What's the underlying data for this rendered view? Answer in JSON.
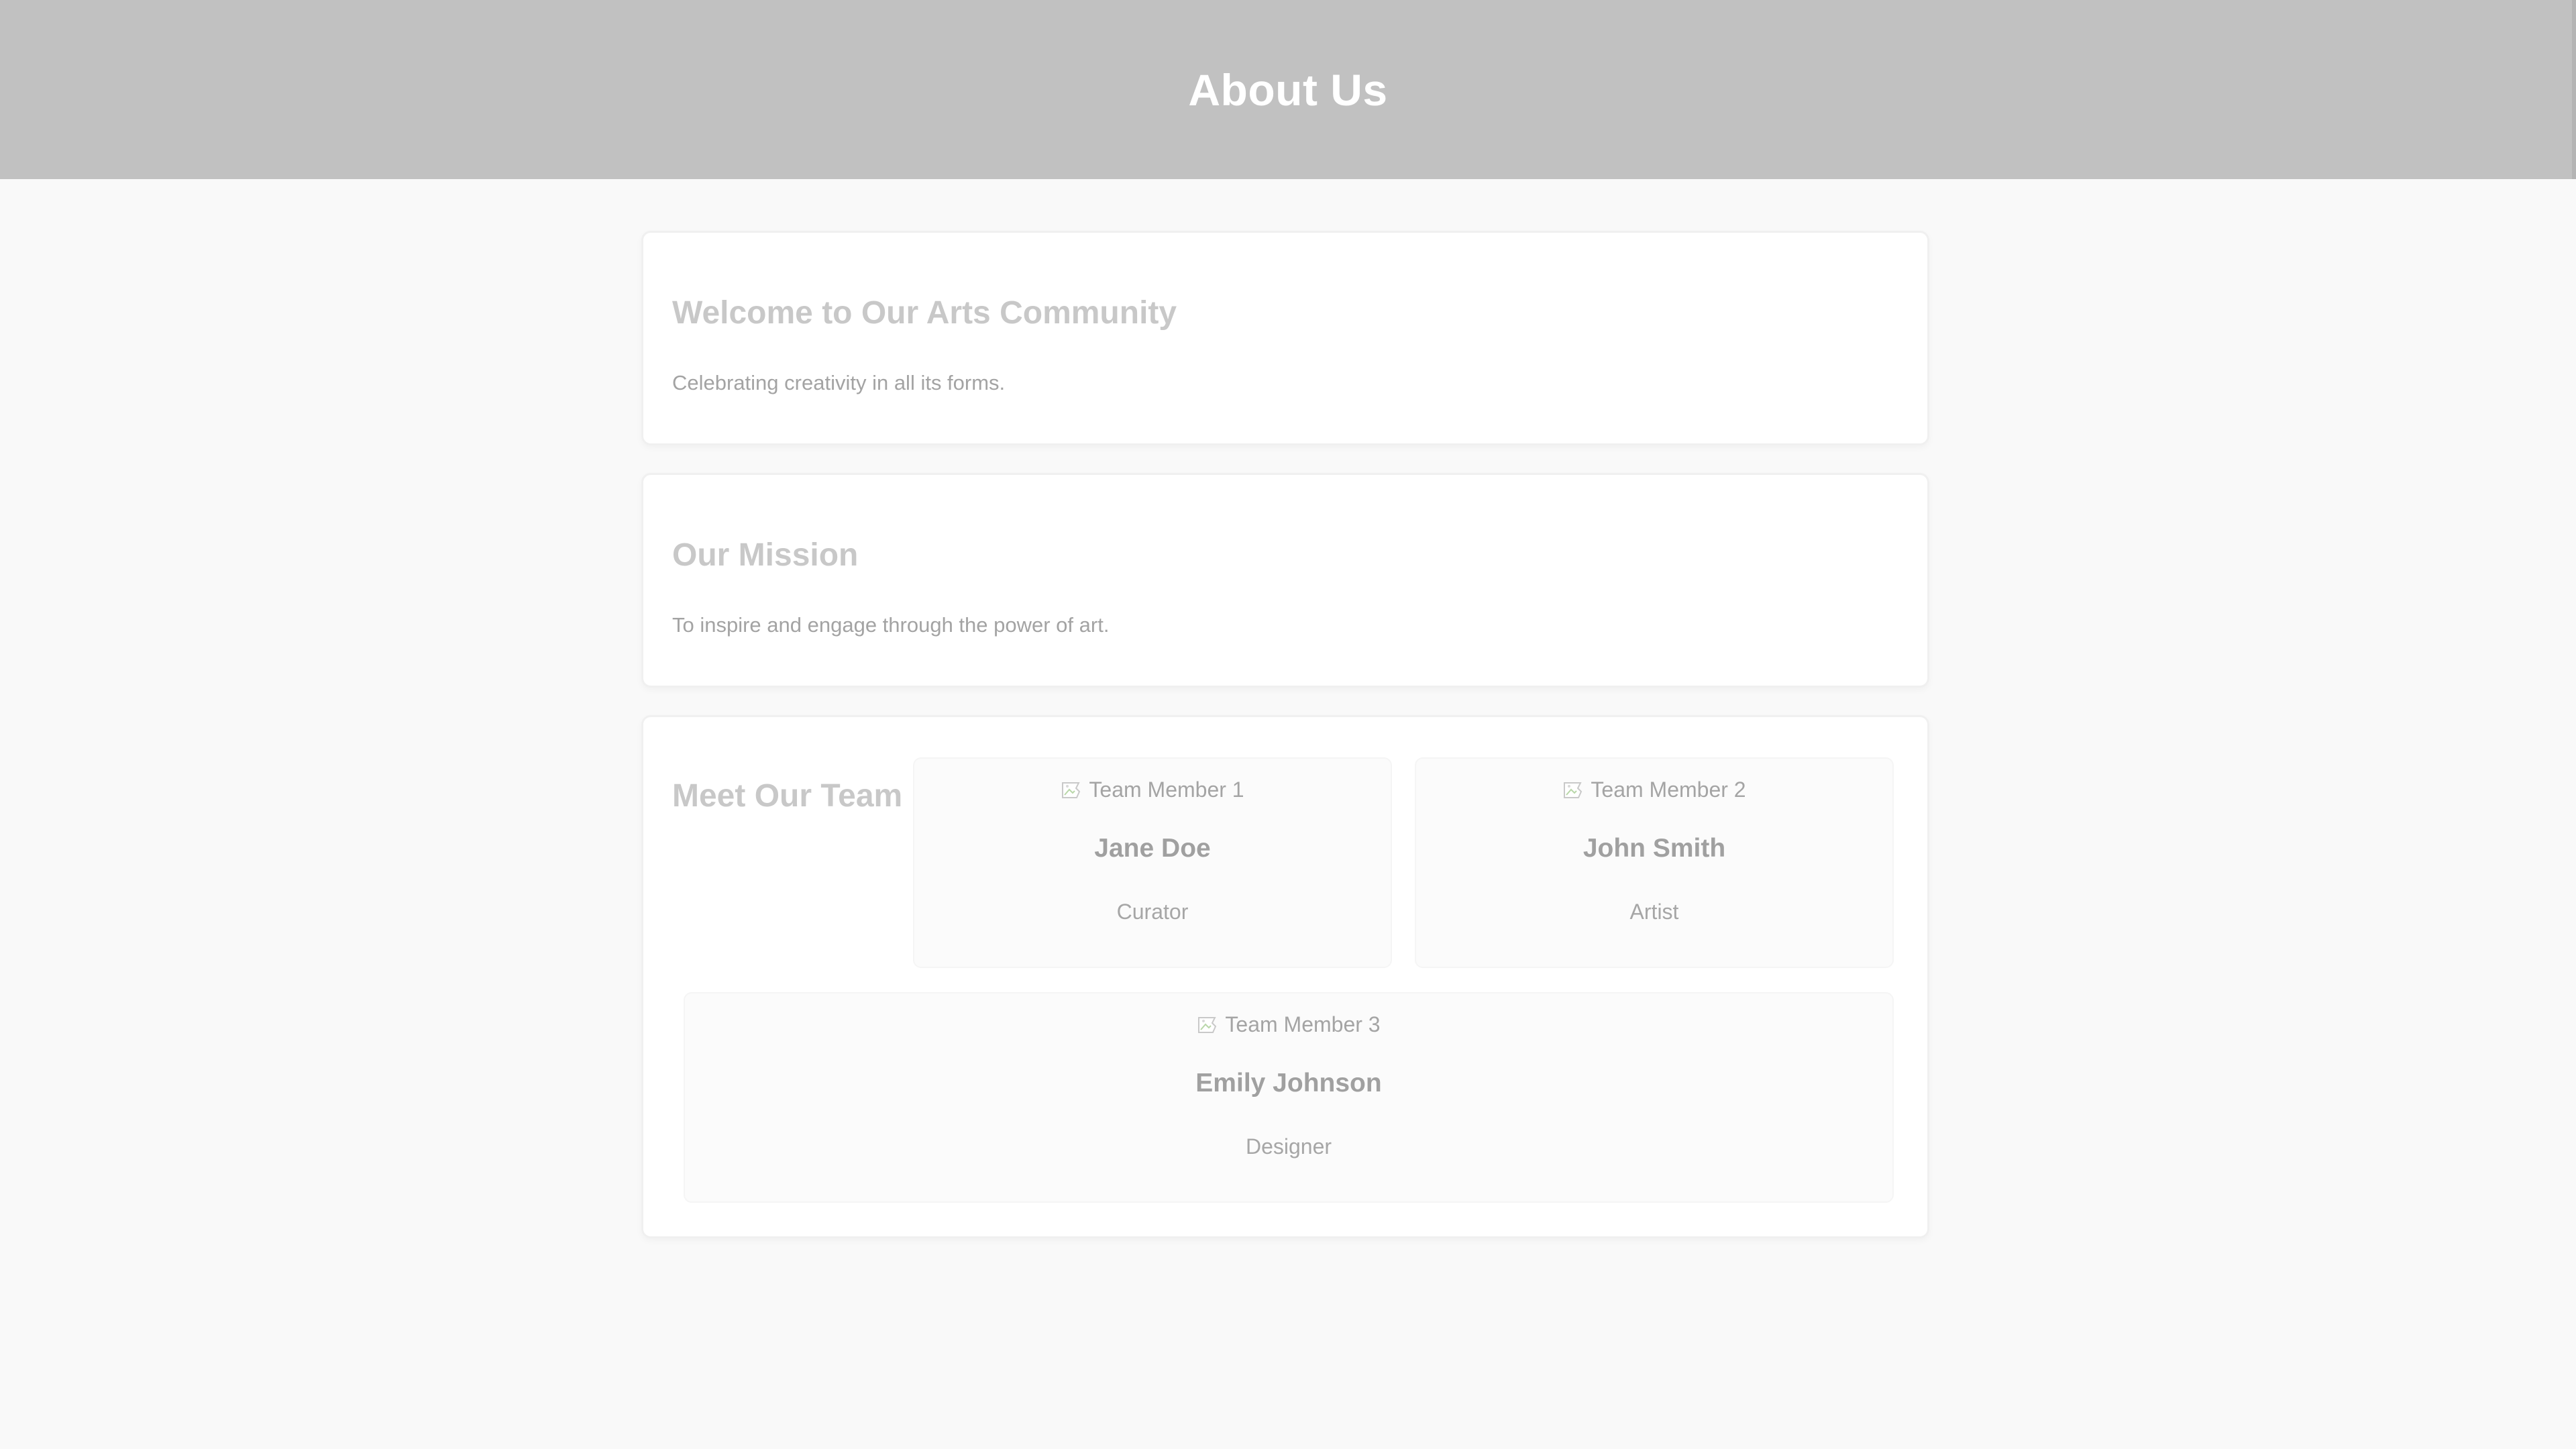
{
  "header": {
    "title": "About Us"
  },
  "sections": {
    "welcome": {
      "heading": "Welcome to Our Arts Community",
      "text": "Celebrating creativity in all its forms."
    },
    "mission": {
      "heading": "Our Mission",
      "text": "To inspire and engage through the power of art."
    },
    "team": {
      "heading": "Meet Our Team",
      "members": [
        {
          "image_alt": "Team Member 1",
          "name": "Jane Doe",
          "role": "Curator"
        },
        {
          "image_alt": "Team Member 2",
          "name": "John Smith",
          "role": "Artist"
        },
        {
          "image_alt": "Team Member 3",
          "name": "Emily Johnson",
          "role": "Designer"
        }
      ]
    }
  },
  "colors": {
    "header_bg": "#c1c1c1",
    "page_bg": "#f9f9f9",
    "card_bg": "#ffffff",
    "heading": "#c8c8c8",
    "text": "#a3a3a3"
  },
  "icons": {
    "member_image": "broken-image-icon"
  }
}
